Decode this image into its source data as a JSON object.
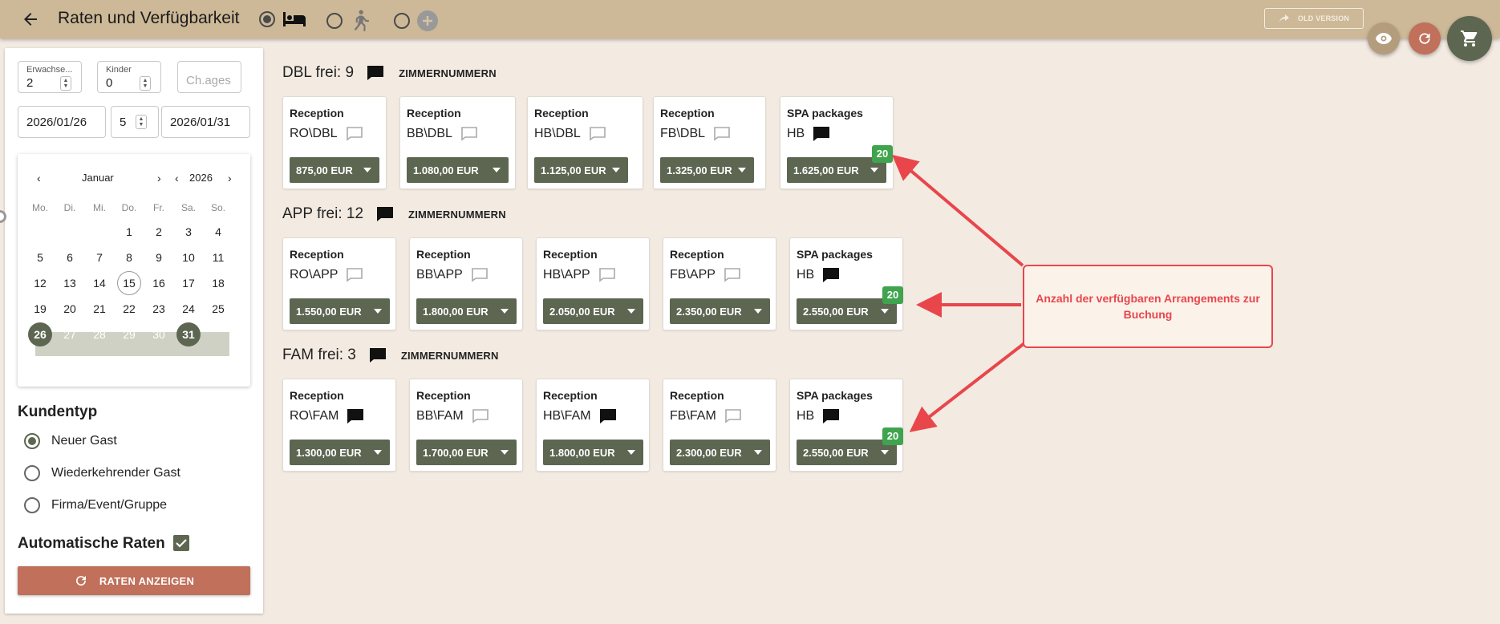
{
  "header": {
    "title": "Raten und Verfügbarkeit",
    "old_version_label": "OLD VERSION"
  },
  "search": {
    "adults_label": "Erwachse...",
    "adults_value": "2",
    "children_label": "Kinder",
    "children_value": "0",
    "child_ages_placeholder": "Ch.ages",
    "arrival": "2026/01/26",
    "nights": "5",
    "departure": "2026/01/31"
  },
  "calendar": {
    "month": "Januar",
    "year": "2026",
    "weekdays": [
      "Mo.",
      "Di.",
      "Mi.",
      "Do.",
      "Fr.",
      "Sa.",
      "So."
    ],
    "weeks": [
      [
        "",
        "",
        "",
        "1",
        "2",
        "3",
        "4"
      ],
      [
        "5",
        "6",
        "7",
        "8",
        "9",
        "10",
        "11"
      ],
      [
        "12",
        "13",
        "14",
        "15",
        "16",
        "17",
        "18"
      ],
      [
        "19",
        "20",
        "21",
        "22",
        "23",
        "24",
        "25"
      ],
      [
        "26",
        "27",
        "28",
        "29",
        "30",
        "31",
        ""
      ]
    ],
    "today": "15",
    "range_start": "26",
    "range_end": "31"
  },
  "customer_type": {
    "title": "Kundentyp",
    "options": [
      "Neuer Gast",
      "Wiederkehrender Gast",
      "Firma/Event/Gruppe"
    ],
    "selected": "Neuer Gast"
  },
  "auto_rates": {
    "label": "Automatische Raten",
    "checked": true
  },
  "rates_button": "RATEN ANZEIGEN",
  "room_number_label": "ZIMMERNUMMERN",
  "rooms": [
    {
      "title": "DBL frei: 9",
      "cards": [
        {
          "category": "Reception",
          "code": "RO\\DBL",
          "note_filled": false,
          "price": "875,00 EUR"
        },
        {
          "category": "Reception",
          "code": "BB\\DBL",
          "note_filled": false,
          "price": "1.080,00 EUR"
        },
        {
          "category": "Reception",
          "code": "HB\\DBL",
          "note_filled": false,
          "price": "1.125,00 EUR"
        },
        {
          "category": "Reception",
          "code": "FB\\DBL",
          "note_filled": false,
          "price": "1.325,00 EUR"
        },
        {
          "category": "SPA packages",
          "code": "HB",
          "note_filled": true,
          "price": "1.625,00 EUR",
          "badge": "20"
        }
      ]
    },
    {
      "title": "APP frei: 12",
      "cards": [
        {
          "category": "Reception",
          "code": "RO\\APP",
          "note_filled": false,
          "price": "1.550,00 EUR"
        },
        {
          "category": "Reception",
          "code": "BB\\APP",
          "note_filled": false,
          "price": "1.800,00 EUR"
        },
        {
          "category": "Reception",
          "code": "HB\\APP",
          "note_filled": false,
          "price": "2.050,00 EUR"
        },
        {
          "category": "Reception",
          "code": "FB\\APP",
          "note_filled": false,
          "price": "2.350,00 EUR"
        },
        {
          "category": "SPA packages",
          "code": "HB",
          "note_filled": true,
          "price": "2.550,00 EUR",
          "badge": "20"
        }
      ]
    },
    {
      "title": "FAM frei: 3",
      "cards": [
        {
          "category": "Reception",
          "code": "RO\\FAM",
          "note_filled": true,
          "price": "1.300,00 EUR"
        },
        {
          "category": "Reception",
          "code": "BB\\FAM",
          "note_filled": false,
          "price": "1.700,00 EUR"
        },
        {
          "category": "Reception",
          "code": "HB\\FAM",
          "note_filled": true,
          "price": "1.800,00 EUR"
        },
        {
          "category": "Reception",
          "code": "FB\\FAM",
          "note_filled": false,
          "price": "2.300,00 EUR"
        },
        {
          "category": "SPA packages",
          "code": "HB",
          "note_filled": true,
          "price": "2.550,00 EUR",
          "badge": "20"
        }
      ]
    }
  ],
  "annotation": "Anzahl der verfügbaren Arrangements zur Buchung",
  "colors": {
    "header": "#cdb998",
    "accent_green": "#5d6651",
    "accent_red": "#c0705b",
    "badge_green": "#3fa44d",
    "annotation_red": "#e8464b"
  }
}
